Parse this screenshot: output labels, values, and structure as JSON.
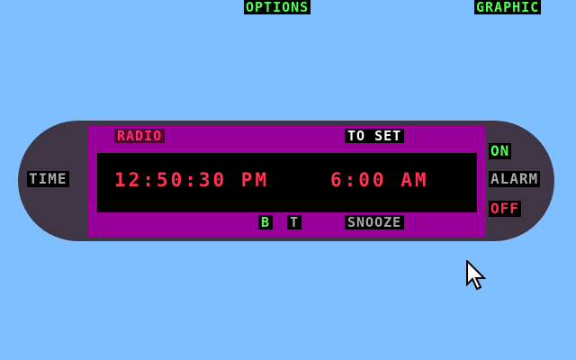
{
  "menu": {
    "options": "OPTIONS",
    "graphic": "GRAPHIC"
  },
  "clock": {
    "time_label": "TIME",
    "radio_button": "RADIO",
    "to_set_button": "TO SET",
    "current_time": "12:50:30 PM",
    "alarm_time": "6:00 AM",
    "b_button": "B",
    "t_button": "T",
    "snooze_button": "SNOOZE"
  },
  "alarm": {
    "on_label": "ON",
    "label": "ALARM",
    "off_label": "OFF"
  },
  "colors": {
    "desktop": "#80bfff",
    "clock_body": "#3f3544",
    "clock_face": "#990099",
    "display": "#000000",
    "digits": "#ff3355",
    "menu_text": "#55ff55"
  },
  "icons": {
    "cursor": "mouse-pointer-icon"
  }
}
